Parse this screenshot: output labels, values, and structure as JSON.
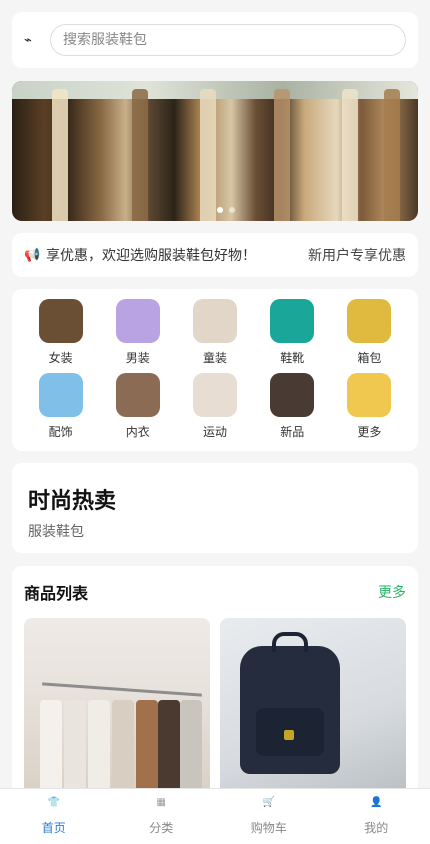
{
  "search": {
    "logo_glyph": "⌁",
    "placeholder": "搜索服装鞋包"
  },
  "banner": {
    "slide_count": 2,
    "active_slide": 1
  },
  "notice": {
    "icon": "speaker-icon",
    "text": "享优惠，欢迎选购服装鞋包好物！",
    "right_text": "新用户专享优惠"
  },
  "categories": [
    {
      "label": "女装",
      "color": "#6b4f35"
    },
    {
      "label": "男装",
      "color": "#b9a3e3"
    },
    {
      "label": "童装",
      "color": "#e2d6c8"
    },
    {
      "label": "鞋靴",
      "color": "#1aa79a"
    },
    {
      "label": "箱包",
      "color": "#e0b93f"
    },
    {
      "label": "配饰",
      "color": "#7fbfe8"
    },
    {
      "label": "内衣",
      "color": "#8c6b55"
    },
    {
      "label": "运动",
      "color": "#e8ddd2"
    },
    {
      "label": "新品",
      "color": "#4a3a34"
    },
    {
      "label": "更多",
      "color": "#f0c850"
    }
  ],
  "hot": {
    "title": "时尚热卖",
    "subtitle": "服装鞋包"
  },
  "products": {
    "title": "商品列表",
    "more": "更多"
  },
  "tabbar": [
    {
      "label": "首页",
      "icon": "shirt-icon",
      "active": true
    },
    {
      "label": "分类",
      "icon": "grid-icon",
      "active": false
    },
    {
      "label": "购物车",
      "icon": "cart-icon",
      "active": false
    },
    {
      "label": "我的",
      "icon": "user-icon",
      "active": false
    }
  ],
  "colors": {
    "accent_green": "#2db368",
    "tab_active": "#2a7dd1",
    "notice_icon": "#e85d4a"
  }
}
